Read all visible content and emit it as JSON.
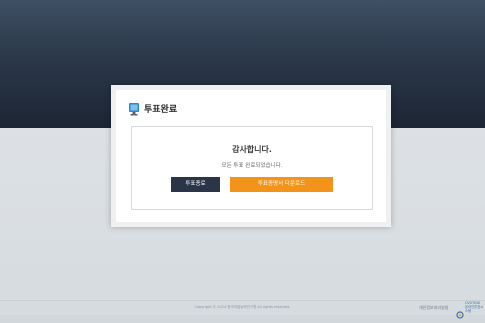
{
  "modal": {
    "title": "투표완료",
    "thanks": "감사합니다.",
    "message": "모든 투표 완료되었습니다.",
    "end_button": "투표종료",
    "download_button": "투표증명서 다운로드"
  },
  "footer": {
    "copyright": "Copyright © 2024 한국직업능력연구원 All rights reserved.",
    "privacy": "개인정보처리방침",
    "logo_line1": "OVOTING",
    "logo_line2": "온라인투표시스템"
  },
  "colors": {
    "header_band": "#1c2533",
    "end_button": "#2a3647",
    "download_button": "#f2931a"
  }
}
